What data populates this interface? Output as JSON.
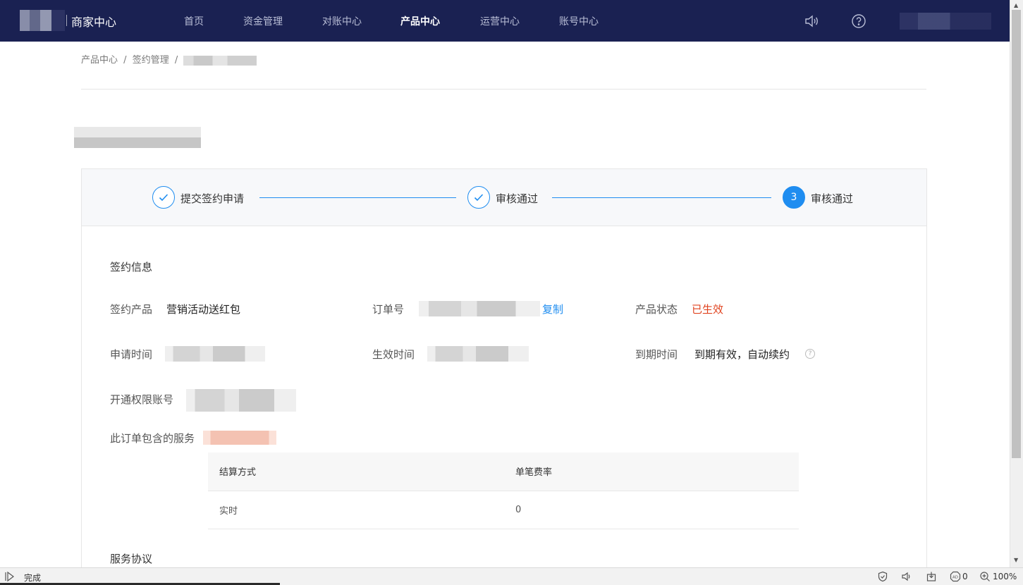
{
  "header": {
    "brand": "商家中心",
    "nav": [
      {
        "label": "首页",
        "active": false
      },
      {
        "label": "资金管理",
        "active": false
      },
      {
        "label": "对账中心",
        "active": false
      },
      {
        "label": "产品中心",
        "active": true
      },
      {
        "label": "运营中心",
        "active": false
      },
      {
        "label": "账号中心",
        "active": false
      }
    ],
    "icons": [
      "speaker-icon",
      "help-icon"
    ]
  },
  "breadcrumb": {
    "items": [
      "产品中心",
      "签约管理"
    ],
    "separator": "/"
  },
  "steps": [
    {
      "label": "提交签约申请",
      "state": "done"
    },
    {
      "label": "审核通过",
      "state": "done"
    },
    {
      "label": "审核通过",
      "state": "current",
      "number": "3"
    }
  ],
  "sign_info": {
    "title": "签约信息",
    "product_label": "签约产品",
    "product_value": "营销活动送红包",
    "order_label": "订单号",
    "copy_label": "复制",
    "status_label": "产品状态",
    "status_value": "已生效",
    "apply_time_label": "申请时间",
    "effective_time_label": "生效时间",
    "expire_time_label": "到期时间",
    "expire_time_value": "到期有效，自动续约",
    "account_label": "开通权限账号",
    "services_label": "此订单包含的服务"
  },
  "service_table": {
    "columns": [
      "结算方式",
      "单笔费率"
    ],
    "rows": [
      [
        "实时",
        "0"
      ]
    ]
  },
  "agreement_title": "服务协议",
  "statusbar": {
    "status": "完成",
    "count": "0",
    "zoom": "100%"
  },
  "colors": {
    "nav_bg": "#1a2152",
    "accent": "#1f8df0",
    "status_red": "#e0431f"
  }
}
